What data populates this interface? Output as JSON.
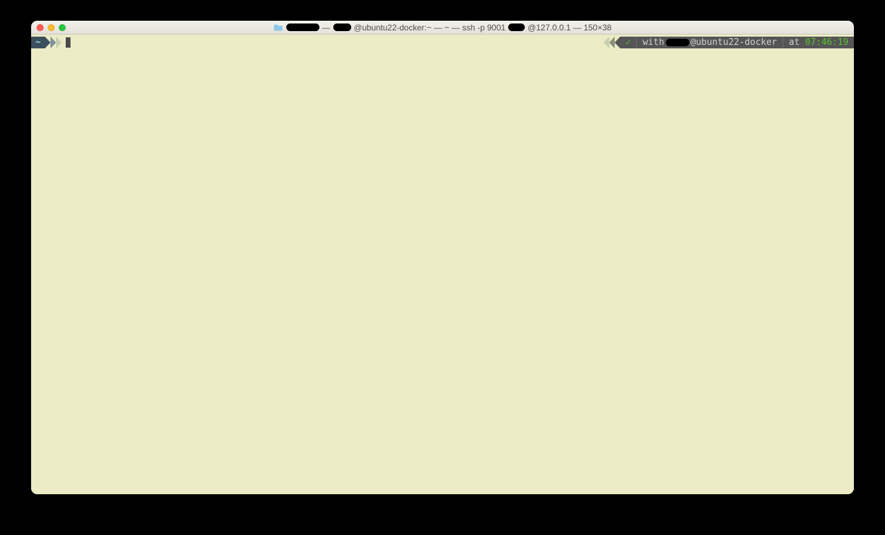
{
  "titlebar": {
    "redacted_a_width": 48,
    "redacted_b_width": 26,
    "redacted_c_width": 24,
    "part1": "@ubuntu22-docker:~ — ~ — ssh -p 9001",
    "part2": "@127.0.0.1 — 150×38",
    "separator": " — "
  },
  "prompt": {
    "path": "~",
    "check": "✓",
    "with_label": "with",
    "user_redacted_width": 34,
    "host": "@ubuntu22-docker",
    "at_label": "at",
    "time": "07:46:19"
  },
  "colors": {
    "term_bg": "#ebecc5",
    "seg_bg": "#555555",
    "seg_dark": "#3c4f5c",
    "accent_cyan": "#9fd8e8",
    "accent_green": "#59c330"
  }
}
